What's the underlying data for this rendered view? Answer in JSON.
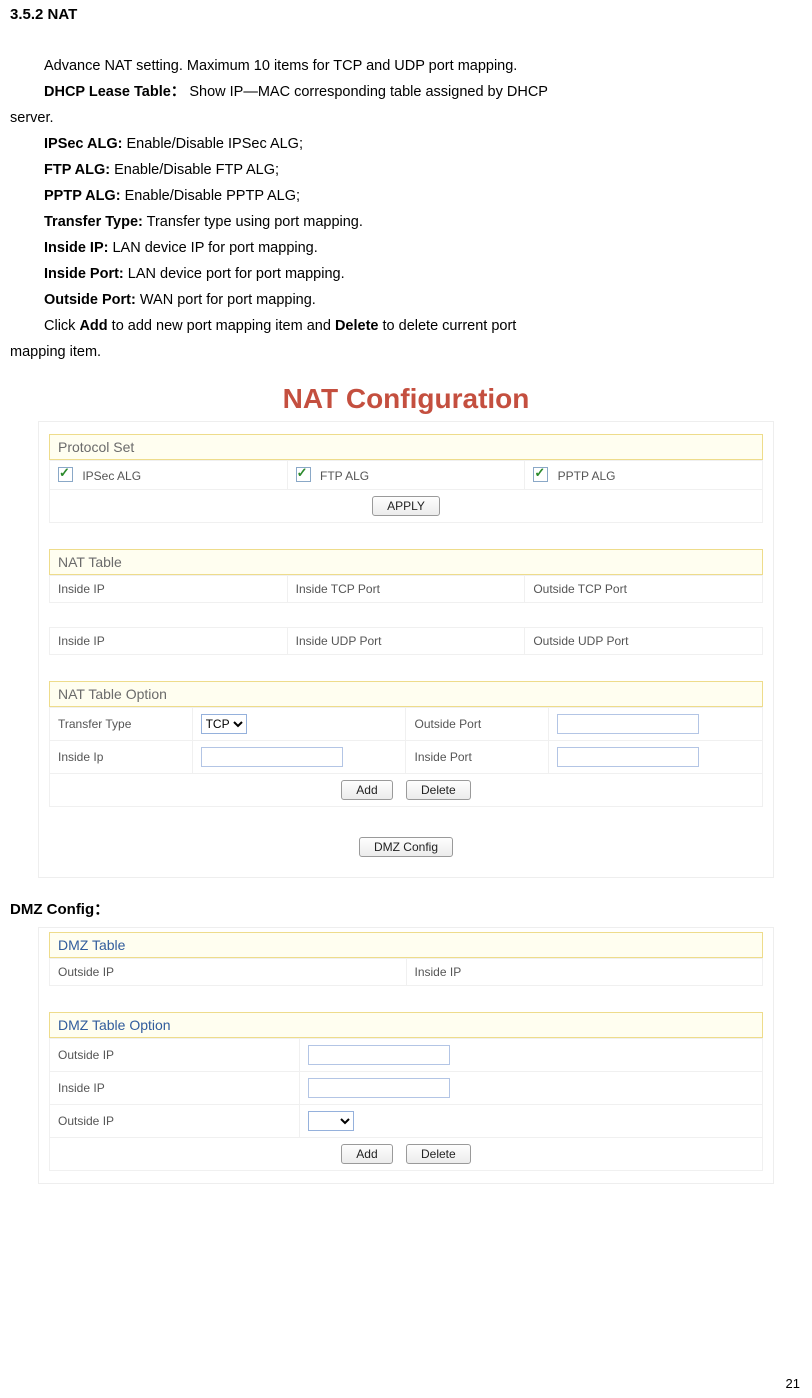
{
  "sectionNumber": "3.5.2 NAT",
  "text": {
    "intro": "Advance NAT setting. Maximum 10 items for TCP and UDP port mapping.",
    "dhcp_label": "DHCP Lease Table：",
    "dhcp_body": "Show IP—MAC corresponding table assigned by DHCP",
    "dhcp_tail": "server.",
    "ipsec_label": "IPSec ALG:",
    "ipsec_body": " Enable/Disable IPSec ALG;",
    "ftp_label": "FTP ALG:",
    "ftp_body": "  Enable/Disable FTP ALG;",
    "pptp_label": "PPTP ALG:",
    "pptp_body": " Enable/Disable PPTP ALG;",
    "tt_label": "Transfer Type:",
    "tt_body": " Transfer type using port mapping.",
    "iip_label": "Inside IP:",
    "iip_body": " LAN device IP for port mapping.",
    "ipo_label": "Inside Port:",
    "ipo_body": "   LAN device port for port mapping.",
    "opo_label": "Outside Port:",
    "opo_body": " WAN port for port mapping.",
    "click1": "Click ",
    "add": "Add",
    "click2": " to add new port mapping item and ",
    "delete": "Delete",
    "click3": " to delete current port",
    "click_tail": "mapping item."
  },
  "nat": {
    "title": "NAT Configuration",
    "protocolSet": "Protocol Set",
    "ipsec": "IPSec ALG",
    "ftp": "FTP ALG",
    "pptp": "PPTP ALG",
    "apply": "APPLY",
    "natTable": "NAT Table",
    "insideIP": "Inside IP",
    "insideTCP": "Inside TCP Port",
    "outsideTCP": "Outside TCP Port",
    "insideUDP": "Inside UDP Port",
    "outsideUDP": "Outside UDP Port",
    "natTableOption": "NAT Table Option",
    "transferType": "Transfer Type",
    "tcp": "TCP",
    "outsidePort": "Outside Port",
    "insideIpLower": "Inside Ip",
    "insidePort": "Inside Port",
    "addBtn": "Add",
    "deleteBtn": "Delete",
    "dmzConfigBtn": "DMZ Config"
  },
  "dmz": {
    "heading": "DMZ Config：",
    "dmzTable": "DMZ Table",
    "outsideIP": "Outside IP",
    "insideIP": "Inside IP",
    "dmzTableOption": "DMZ Table Option",
    "addBtn": "Add",
    "deleteBtn": "Delete"
  },
  "pageNumber": "21"
}
